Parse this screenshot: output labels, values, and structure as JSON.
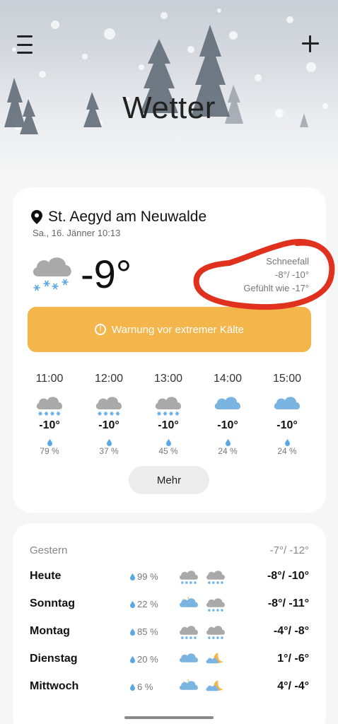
{
  "header": {
    "title": "Wetter",
    "menu_icon": "hamburger-menu-icon",
    "add_icon": "plus-icon"
  },
  "current": {
    "location": "St. Aegyd am Neuwalde",
    "datetime": "Sa., 16. Jänner 10:13",
    "temperature": "-9°",
    "condition": "Schneefall",
    "high_low": "-8°/ -10°",
    "feels_like": "Gefühlt wie -17°",
    "icon": "snow-cloud-icon"
  },
  "warning": {
    "text": "Warnung vor extremer Kälte",
    "color": "#f4b54b"
  },
  "hourly": [
    {
      "time": "11:00",
      "icon": "snow-cloud",
      "temp": "-10°",
      "precip": "79 %"
    },
    {
      "time": "12:00",
      "icon": "snow-cloud",
      "temp": "-10°",
      "precip": "37 %"
    },
    {
      "time": "13:00",
      "icon": "snow-cloud",
      "temp": "-10°",
      "precip": "45 %"
    },
    {
      "time": "14:00",
      "icon": "cloud",
      "temp": "-10°",
      "precip": "24 %"
    },
    {
      "time": "15:00",
      "icon": "cloud",
      "temp": "-10°",
      "precip": "24 %"
    }
  ],
  "more_label": "Mehr",
  "daily": {
    "yesterday": {
      "label": "Gestern",
      "range": "-7°/ -12°"
    },
    "days": [
      {
        "name": "Heute",
        "precip": "99 %",
        "icons": [
          "snow-cloud",
          "snow-cloud"
        ],
        "range": "-8°/ -10°"
      },
      {
        "name": "Sonntag",
        "precip": "22 %",
        "icons": [
          "sun-cloud",
          "snow-cloud"
        ],
        "range": "-8°/ -11°"
      },
      {
        "name": "Montag",
        "precip": "85 %",
        "icons": [
          "snow-cloud",
          "snow-cloud"
        ],
        "range": "-4°/ -8°"
      },
      {
        "name": "Dienstag",
        "precip": "20 %",
        "icons": [
          "cloud",
          "moon-cloud"
        ],
        "range": "1°/ -6°"
      },
      {
        "name": "Mittwoch",
        "precip": "6 %",
        "icons": [
          "sun-cloud",
          "moon-cloud"
        ],
        "range": "4°/ -4°"
      }
    ]
  },
  "colors": {
    "accent_blue": "#7ab4e0",
    "warning": "#f4b54b",
    "annotation_red": "#e0301e"
  }
}
